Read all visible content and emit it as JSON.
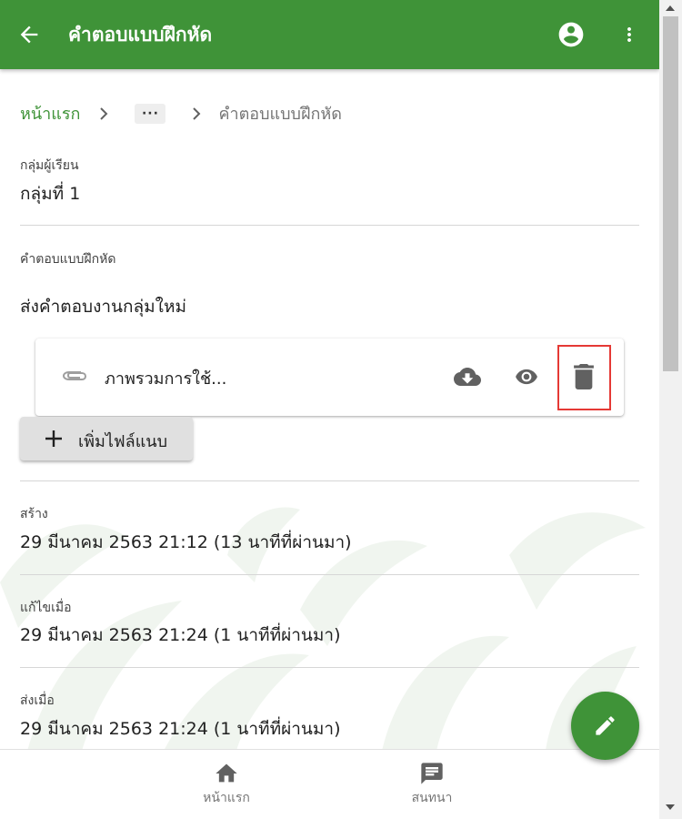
{
  "appbar": {
    "title": "คำตอบแบบฝึกหัด",
    "color": "#3f9338"
  },
  "breadcrumb": {
    "home": "หน้าแรก",
    "ellipsis": "···",
    "current": "คำตอบแบบฝึกหัด"
  },
  "group": {
    "label": "กลุ่มผู้เรียน",
    "value": "กลุ่มที่ 1"
  },
  "answer": {
    "label": "คำตอบแบบฝึกหัด",
    "value": "ส่งคำตอบงานกลุ่มใหม่",
    "file": {
      "name": "ภาพรวมการใช้...",
      "icons": [
        "paperclip-icon",
        "cloud-download-icon",
        "eye-icon",
        "trash-icon"
      ]
    },
    "add_file_label": "เพิ่มไฟล์แนบ"
  },
  "created": {
    "label": "สร้าง",
    "value": "29 มีนาคม 2563 21:12  (13 นาทีที่ผ่านมา)"
  },
  "edited": {
    "label": "แก้ไขเมื่อ",
    "value": "29 มีนาคม 2563 21:24  (1 นาทีที่ผ่านมา)"
  },
  "submitted": {
    "label": "ส่งเมื่อ",
    "value": "29 มีนาคม 2563 21:24  (1 นาทีที่ผ่านมา)"
  },
  "bottom_nav": {
    "items": [
      {
        "label": "หน้าแรก",
        "icon": "home-icon"
      },
      {
        "label": "สนทนา",
        "icon": "chat-icon"
      }
    ]
  },
  "colors": {
    "primary": "#3f9338",
    "highlight": "#e53935"
  }
}
